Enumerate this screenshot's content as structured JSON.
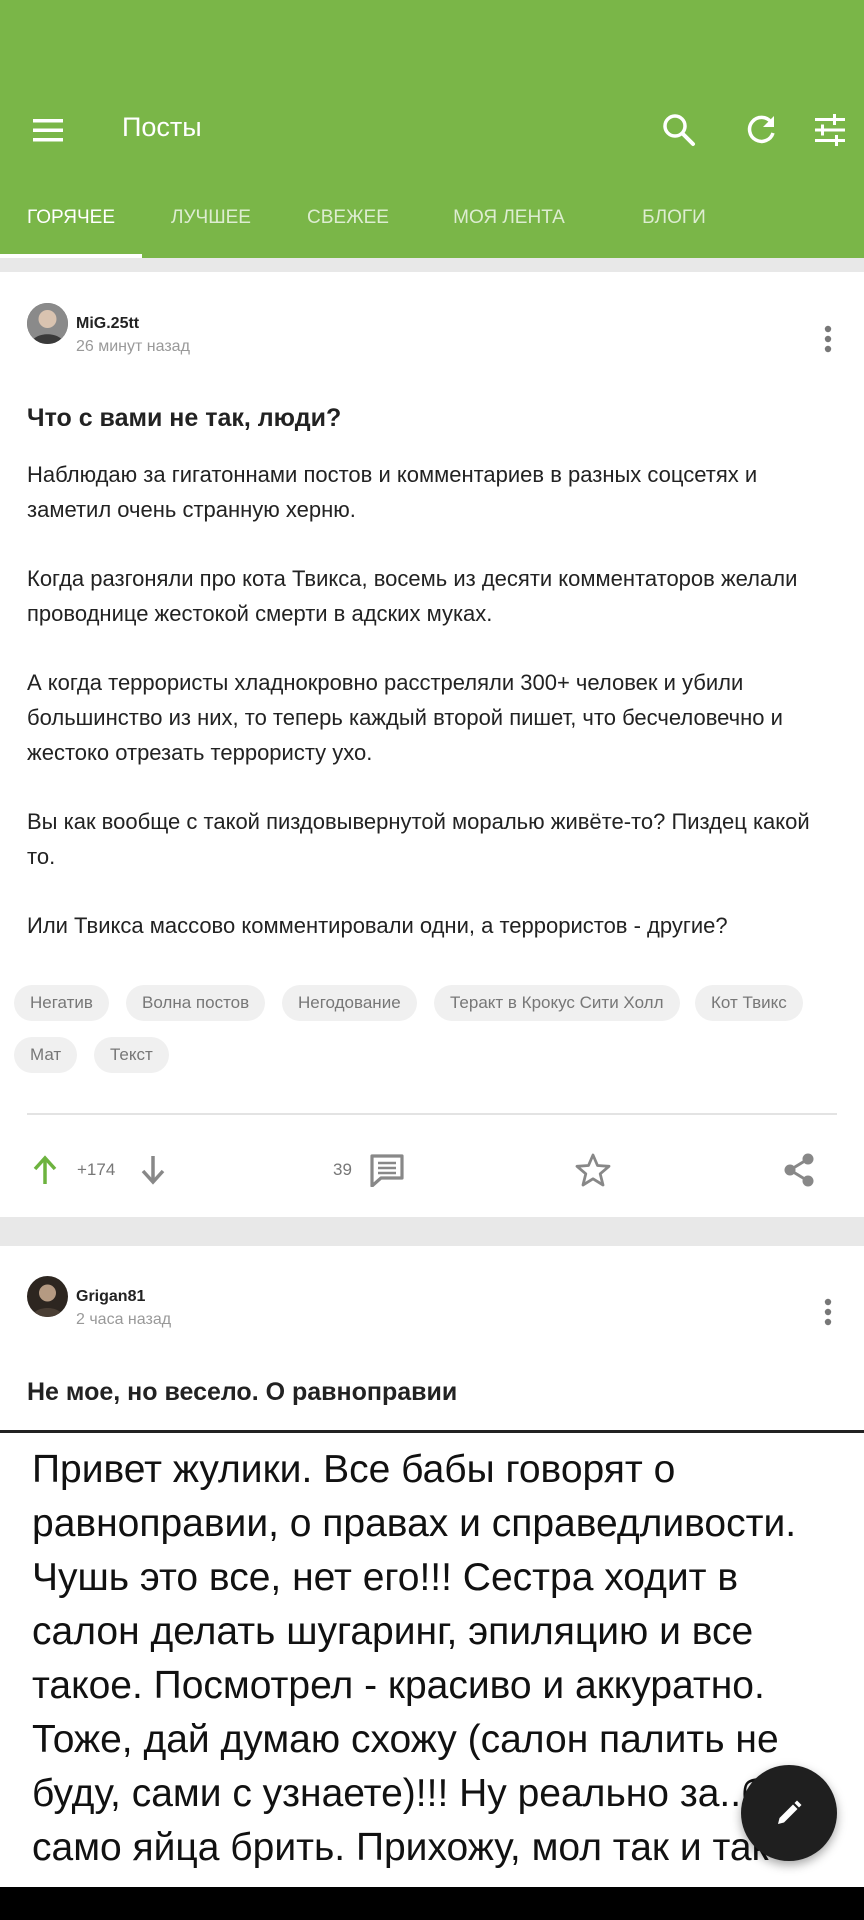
{
  "header": {
    "title": "Посты",
    "tabs": [
      {
        "label": "ГОРЯЧЕЕ",
        "active": true
      },
      {
        "label": "ЛУЧШЕЕ",
        "active": false
      },
      {
        "label": "СВЕЖЕЕ",
        "active": false
      },
      {
        "label": "МОЯ ЛЕНТА",
        "active": false
      },
      {
        "label": "БЛОГИ",
        "active": false
      }
    ],
    "icons": [
      "menu-icon",
      "search-icon",
      "refresh-icon",
      "filter-icon"
    ],
    "accent_color": "#7ab648"
  },
  "posts": [
    {
      "author": "MiG.25tt",
      "time": "26 минут назад",
      "title": "Что с вами не так, люди?",
      "paragraphs": [
        "Наблюдаю за гигатоннами постов и комментариев в разных соцсетях и заметил очень странную херню.",
        "Когда разгоняли про кота Твикса, восемь из десяти комментаторов желали проводнице жестокой смерти в адских муках.",
        "А когда террористы хладнокровно расстреляли 300+ человек и убили большинство из них, то теперь каждый второй пишет, что бесчеловечно и жестоко отрезать террористу ухо.",
        "Вы как вообще с такой пиздовывернутой моралью живёте-то? Пиздец какой то.",
        "Или Твикса массово комментировали одни, а террористов - другие?"
      ],
      "tags": [
        "Негатив",
        "Волна постов",
        "Негодование",
        "Теракт в Крокус Сити Холл",
        "Кот Твикс",
        "Мат",
        "Текст"
      ],
      "rating": "+174",
      "comments": "39"
    },
    {
      "author": "Grigan81",
      "time": "2 часа назад",
      "title": "Не мое, но весело. О равноправии",
      "image_text": "Привет жулики. Все бабы говорят о равноправии, о правах и справедливости. Чушь это все, нет его!!! Сестра ходит в салон делать шугаринг, эпиляцию и все такое. Посмотрел - красиво и аккуратно. Тоже, дай думаю схожу (салон палить не буду, сами с узнаете)!!! Ну реально за..бало само яйца брить. Прихожу, мол так и так"
    }
  ]
}
